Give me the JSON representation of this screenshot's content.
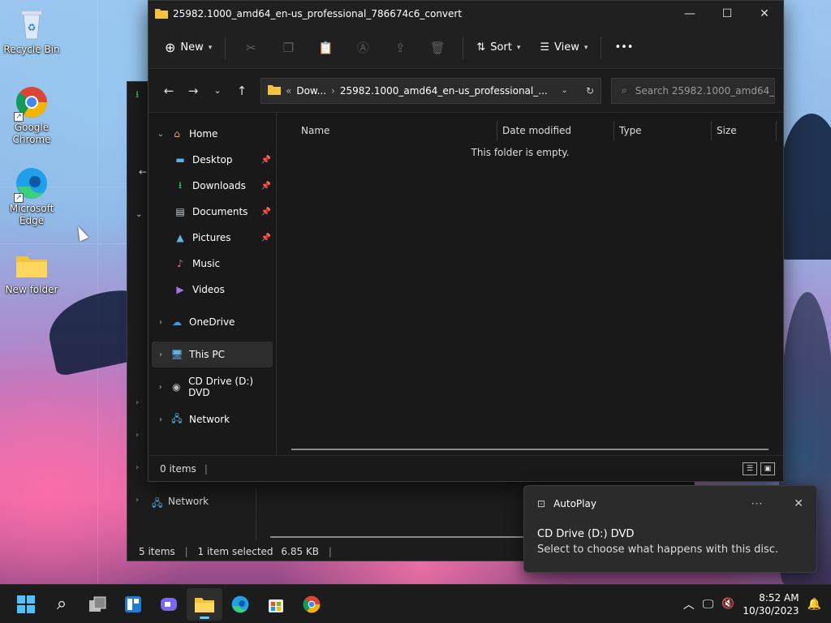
{
  "desktop": {
    "icons": [
      {
        "label": "Recycle Bin"
      },
      {
        "label": "Google Chrome"
      },
      {
        "label": "Microsoft Edge"
      },
      {
        "label": "New folder"
      }
    ]
  },
  "window": {
    "title": "25982.1000_amd64_en-us_professional_786674c6_convert",
    "controls": {
      "minimize": "—",
      "maximize": "☐",
      "close": "✕"
    }
  },
  "toolbar": {
    "new_label": "New",
    "sort_label": "Sort",
    "view_label": "View",
    "more_label": "•••"
  },
  "address": {
    "prefix": "«",
    "crumb1": "Dow...",
    "sep": "›",
    "crumb2": "25982.1000_amd64_en-us_professional_..."
  },
  "search": {
    "placeholder": "Search 25982.1000_amd64_e..."
  },
  "sidebar": {
    "items": [
      {
        "label": "Home"
      },
      {
        "label": "Desktop"
      },
      {
        "label": "Downloads"
      },
      {
        "label": "Documents"
      },
      {
        "label": "Pictures"
      },
      {
        "label": "Music"
      },
      {
        "label": "Videos"
      },
      {
        "label": "OneDrive"
      },
      {
        "label": "This PC"
      },
      {
        "label": "CD Drive (D:) DVD"
      },
      {
        "label": "Network"
      }
    ]
  },
  "columns": {
    "name": "Name",
    "date": "Date modified",
    "type": "Type",
    "size": "Size"
  },
  "content": {
    "empty_text": "This folder is empty."
  },
  "status": {
    "items": "0 items"
  },
  "back_window": {
    "network_label": "Network",
    "status_items": "5 items",
    "status_selected": "1 item selected",
    "status_size": "6.85 KB"
  },
  "toast": {
    "app": "AutoPlay",
    "more": "···",
    "close": "✕",
    "title": "CD Drive (D:) DVD",
    "message": "Select to choose what happens with this disc."
  },
  "clock": {
    "time": "8:52 AM",
    "date": "10/30/2023"
  },
  "colors": {
    "accent": "#60cdff",
    "folder": "#f3c33c"
  }
}
